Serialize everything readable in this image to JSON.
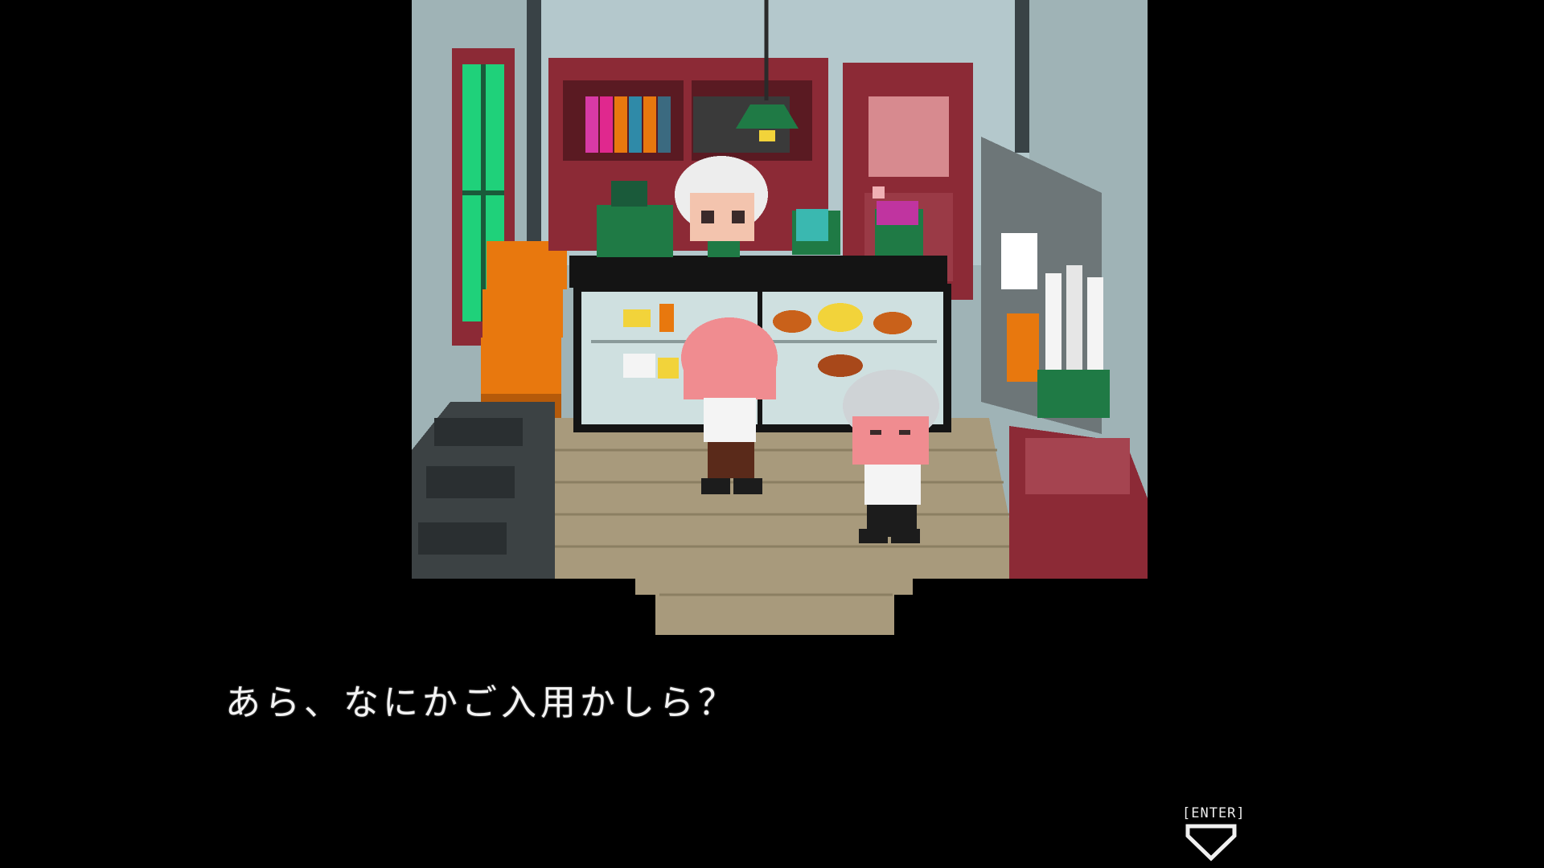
{
  "dialogue": {
    "text": "あら、なにかご入用かしら？"
  },
  "prompt": {
    "label": "[ENTER]",
    "icon": "down-arrow-icon"
  },
  "colors": {
    "background": "#000000",
    "wall": "#9fb3b6",
    "floor": "#a89a7c",
    "shelf_red": "#8c2a36",
    "register_green": "#1f7a45",
    "hair_pink": "#f08c90",
    "hair_silver": "#cfd3d6"
  }
}
